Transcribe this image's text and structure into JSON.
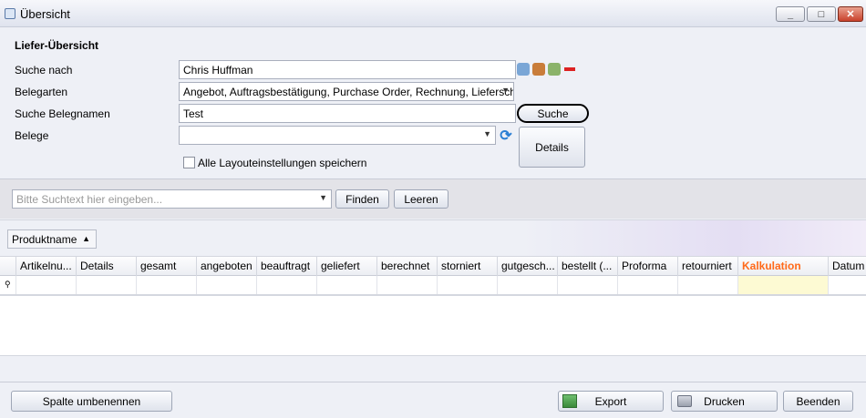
{
  "window": {
    "title": "Übersicht",
    "minimize": "_",
    "maximize": "□",
    "close": "✕"
  },
  "form": {
    "section_title": "Liefer-Übersicht",
    "search_by": {
      "label": "Suche nach",
      "value": "Chris Huffman"
    },
    "doc_types": {
      "label": "Belegarten",
      "value": "Angebot, Auftragsbestätigung, Purchase Order, Rechnung, Lieferscheine..."
    },
    "doc_name": {
      "label": "Suche Belegnamen",
      "value": "Test"
    },
    "documents": {
      "label": "Belege",
      "value": ""
    },
    "search_button": "Suche",
    "details_button": "Details",
    "save_layout_checkbox": "Alle Layouteinstellungen speichern",
    "icon_names": [
      "person-card-icon",
      "house-icon",
      "people-icon",
      "remove-icon",
      "refresh-icon"
    ]
  },
  "finder": {
    "placeholder": "Bitte Suchtext hier eingeben...",
    "find_button": "Finden",
    "clear_button": "Leeren"
  },
  "grid": {
    "group_chip": "Produktname",
    "columns": [
      "Artikelnu...",
      "Details",
      "gesamt",
      "angeboten",
      "beauftragt",
      "geliefert",
      "berechnet",
      "storniert",
      "gutgesch...",
      "bestellt (...",
      "Proforma",
      "retourniert",
      "Kalkulation",
      "Datum"
    ],
    "highlighted_column": "Kalkulation",
    "highlight_color": "#ff6a1a"
  },
  "bottom": {
    "rename_column_button": "Spalte umbenennen",
    "export_button": "Export",
    "print_button": "Drucken",
    "close_button": "Beenden"
  }
}
